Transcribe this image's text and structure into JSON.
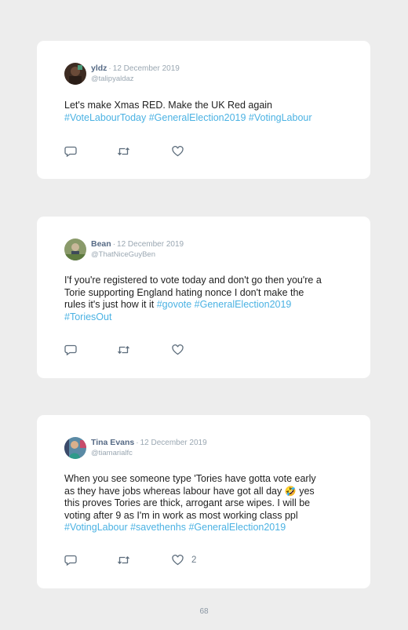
{
  "tweets": [
    {
      "name": "yldz",
      "date": "12 December 2019",
      "handle": "@talipyaldaz",
      "text": "Let's make Xmas RED. Make the UK Red again",
      "hashtags": "#VoteLabourToday #GeneralElection2019 #VotingLabour",
      "likes": ""
    },
    {
      "name": "Bean",
      "date": "12 December 2019",
      "handle": "@ThatNiceGuyBen",
      "text_line1": "I'f you're registered to vote today and don't go then you're a",
      "text_line2": "Torie supporting England hating nonce I don't make the",
      "text_line3": "rules it's just how it it",
      "hashtags_inline": "#govote #GeneralElection2019",
      "hashtags_line": "#ToriesOut",
      "likes": ""
    },
    {
      "name": "Tina Evans",
      "date": "12 December 2019",
      "handle": "@tiamarialfc",
      "text_line1": "When you see someone type 'Tories have gotta vote early",
      "text_line2a": "as they have jobs whereas labour have got all day",
      "emoji": "🤣",
      "text_line2b": "yes",
      "text_line3": "this proves Tories are thick, arrogant arse wipes. I will be",
      "text_line4": "voting after 9 as I'm in work as most working class ppl",
      "hashtags": "#VotingLabour #savethenhs #GeneralElection2019",
      "likes": "2"
    }
  ],
  "separator": "·",
  "page_number": "68",
  "colors": {
    "hashtag": "#4bb2e3",
    "name": "#566a85",
    "meta": "#9aa7b2",
    "page_bg": "#ededed"
  },
  "icons": [
    "reply-icon",
    "retweet-icon",
    "like-icon"
  ]
}
